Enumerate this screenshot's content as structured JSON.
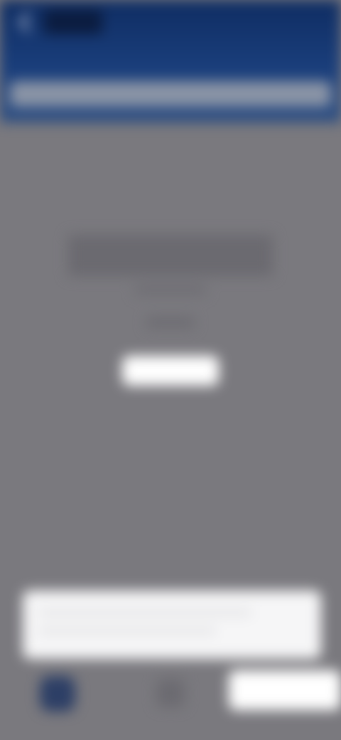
{
  "header": {
    "link_label": "",
    "subtitle": "",
    "search_placeholder": ""
  },
  "main": {
    "heading": "",
    "line1": "",
    "line2": "",
    "button_label": ""
  },
  "prompt": {
    "line1": "",
    "line2": ""
  },
  "bottom": {
    "action_label": ""
  },
  "colors": {
    "header_blue": "#1a3e7b",
    "overlay_gray": "#7a797e",
    "card_white": "#f6f6f7"
  },
  "icons": {
    "back": "back-arrow-icon",
    "avatar": "avatar-icon",
    "middle": "app-icon"
  }
}
